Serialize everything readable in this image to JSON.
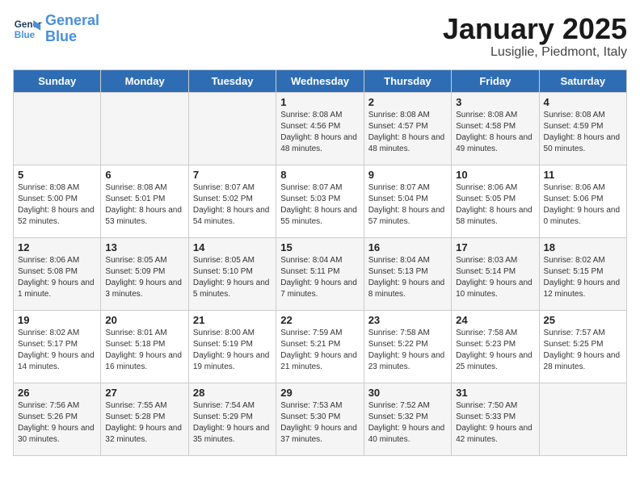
{
  "logo": {
    "line1": "General",
    "line2": "Blue"
  },
  "title": "January 2025",
  "subtitle": "Lusiglie, Piedmont, Italy",
  "weekdays": [
    "Sunday",
    "Monday",
    "Tuesday",
    "Wednesday",
    "Thursday",
    "Friday",
    "Saturday"
  ],
  "weeks": [
    [
      {
        "day": "",
        "info": ""
      },
      {
        "day": "",
        "info": ""
      },
      {
        "day": "",
        "info": ""
      },
      {
        "day": "1",
        "info": "Sunrise: 8:08 AM\nSunset: 4:56 PM\nDaylight: 8 hours\nand 48 minutes."
      },
      {
        "day": "2",
        "info": "Sunrise: 8:08 AM\nSunset: 4:57 PM\nDaylight: 8 hours\nand 48 minutes."
      },
      {
        "day": "3",
        "info": "Sunrise: 8:08 AM\nSunset: 4:58 PM\nDaylight: 8 hours\nand 49 minutes."
      },
      {
        "day": "4",
        "info": "Sunrise: 8:08 AM\nSunset: 4:59 PM\nDaylight: 8 hours\nand 50 minutes."
      }
    ],
    [
      {
        "day": "5",
        "info": "Sunrise: 8:08 AM\nSunset: 5:00 PM\nDaylight: 8 hours\nand 52 minutes."
      },
      {
        "day": "6",
        "info": "Sunrise: 8:08 AM\nSunset: 5:01 PM\nDaylight: 8 hours\nand 53 minutes."
      },
      {
        "day": "7",
        "info": "Sunrise: 8:07 AM\nSunset: 5:02 PM\nDaylight: 8 hours\nand 54 minutes."
      },
      {
        "day": "8",
        "info": "Sunrise: 8:07 AM\nSunset: 5:03 PM\nDaylight: 8 hours\nand 55 minutes."
      },
      {
        "day": "9",
        "info": "Sunrise: 8:07 AM\nSunset: 5:04 PM\nDaylight: 8 hours\nand 57 minutes."
      },
      {
        "day": "10",
        "info": "Sunrise: 8:06 AM\nSunset: 5:05 PM\nDaylight: 8 hours\nand 58 minutes."
      },
      {
        "day": "11",
        "info": "Sunrise: 8:06 AM\nSunset: 5:06 PM\nDaylight: 9 hours\nand 0 minutes."
      }
    ],
    [
      {
        "day": "12",
        "info": "Sunrise: 8:06 AM\nSunset: 5:08 PM\nDaylight: 9 hours\nand 1 minute."
      },
      {
        "day": "13",
        "info": "Sunrise: 8:05 AM\nSunset: 5:09 PM\nDaylight: 9 hours\nand 3 minutes."
      },
      {
        "day": "14",
        "info": "Sunrise: 8:05 AM\nSunset: 5:10 PM\nDaylight: 9 hours\nand 5 minutes."
      },
      {
        "day": "15",
        "info": "Sunrise: 8:04 AM\nSunset: 5:11 PM\nDaylight: 9 hours\nand 7 minutes."
      },
      {
        "day": "16",
        "info": "Sunrise: 8:04 AM\nSunset: 5:13 PM\nDaylight: 9 hours\nand 8 minutes."
      },
      {
        "day": "17",
        "info": "Sunrise: 8:03 AM\nSunset: 5:14 PM\nDaylight: 9 hours\nand 10 minutes."
      },
      {
        "day": "18",
        "info": "Sunrise: 8:02 AM\nSunset: 5:15 PM\nDaylight: 9 hours\nand 12 minutes."
      }
    ],
    [
      {
        "day": "19",
        "info": "Sunrise: 8:02 AM\nSunset: 5:17 PM\nDaylight: 9 hours\nand 14 minutes."
      },
      {
        "day": "20",
        "info": "Sunrise: 8:01 AM\nSunset: 5:18 PM\nDaylight: 9 hours\nand 16 minutes."
      },
      {
        "day": "21",
        "info": "Sunrise: 8:00 AM\nSunset: 5:19 PM\nDaylight: 9 hours\nand 19 minutes."
      },
      {
        "day": "22",
        "info": "Sunrise: 7:59 AM\nSunset: 5:21 PM\nDaylight: 9 hours\nand 21 minutes."
      },
      {
        "day": "23",
        "info": "Sunrise: 7:58 AM\nSunset: 5:22 PM\nDaylight: 9 hours\nand 23 minutes."
      },
      {
        "day": "24",
        "info": "Sunrise: 7:58 AM\nSunset: 5:23 PM\nDaylight: 9 hours\nand 25 minutes."
      },
      {
        "day": "25",
        "info": "Sunrise: 7:57 AM\nSunset: 5:25 PM\nDaylight: 9 hours\nand 28 minutes."
      }
    ],
    [
      {
        "day": "26",
        "info": "Sunrise: 7:56 AM\nSunset: 5:26 PM\nDaylight: 9 hours\nand 30 minutes."
      },
      {
        "day": "27",
        "info": "Sunrise: 7:55 AM\nSunset: 5:28 PM\nDaylight: 9 hours\nand 32 minutes."
      },
      {
        "day": "28",
        "info": "Sunrise: 7:54 AM\nSunset: 5:29 PM\nDaylight: 9 hours\nand 35 minutes."
      },
      {
        "day": "29",
        "info": "Sunrise: 7:53 AM\nSunset: 5:30 PM\nDaylight: 9 hours\nand 37 minutes."
      },
      {
        "day": "30",
        "info": "Sunrise: 7:52 AM\nSunset: 5:32 PM\nDaylight: 9 hours\nand 40 minutes."
      },
      {
        "day": "31",
        "info": "Sunrise: 7:50 AM\nSunset: 5:33 PM\nDaylight: 9 hours\nand 42 minutes."
      },
      {
        "day": "",
        "info": ""
      }
    ]
  ]
}
